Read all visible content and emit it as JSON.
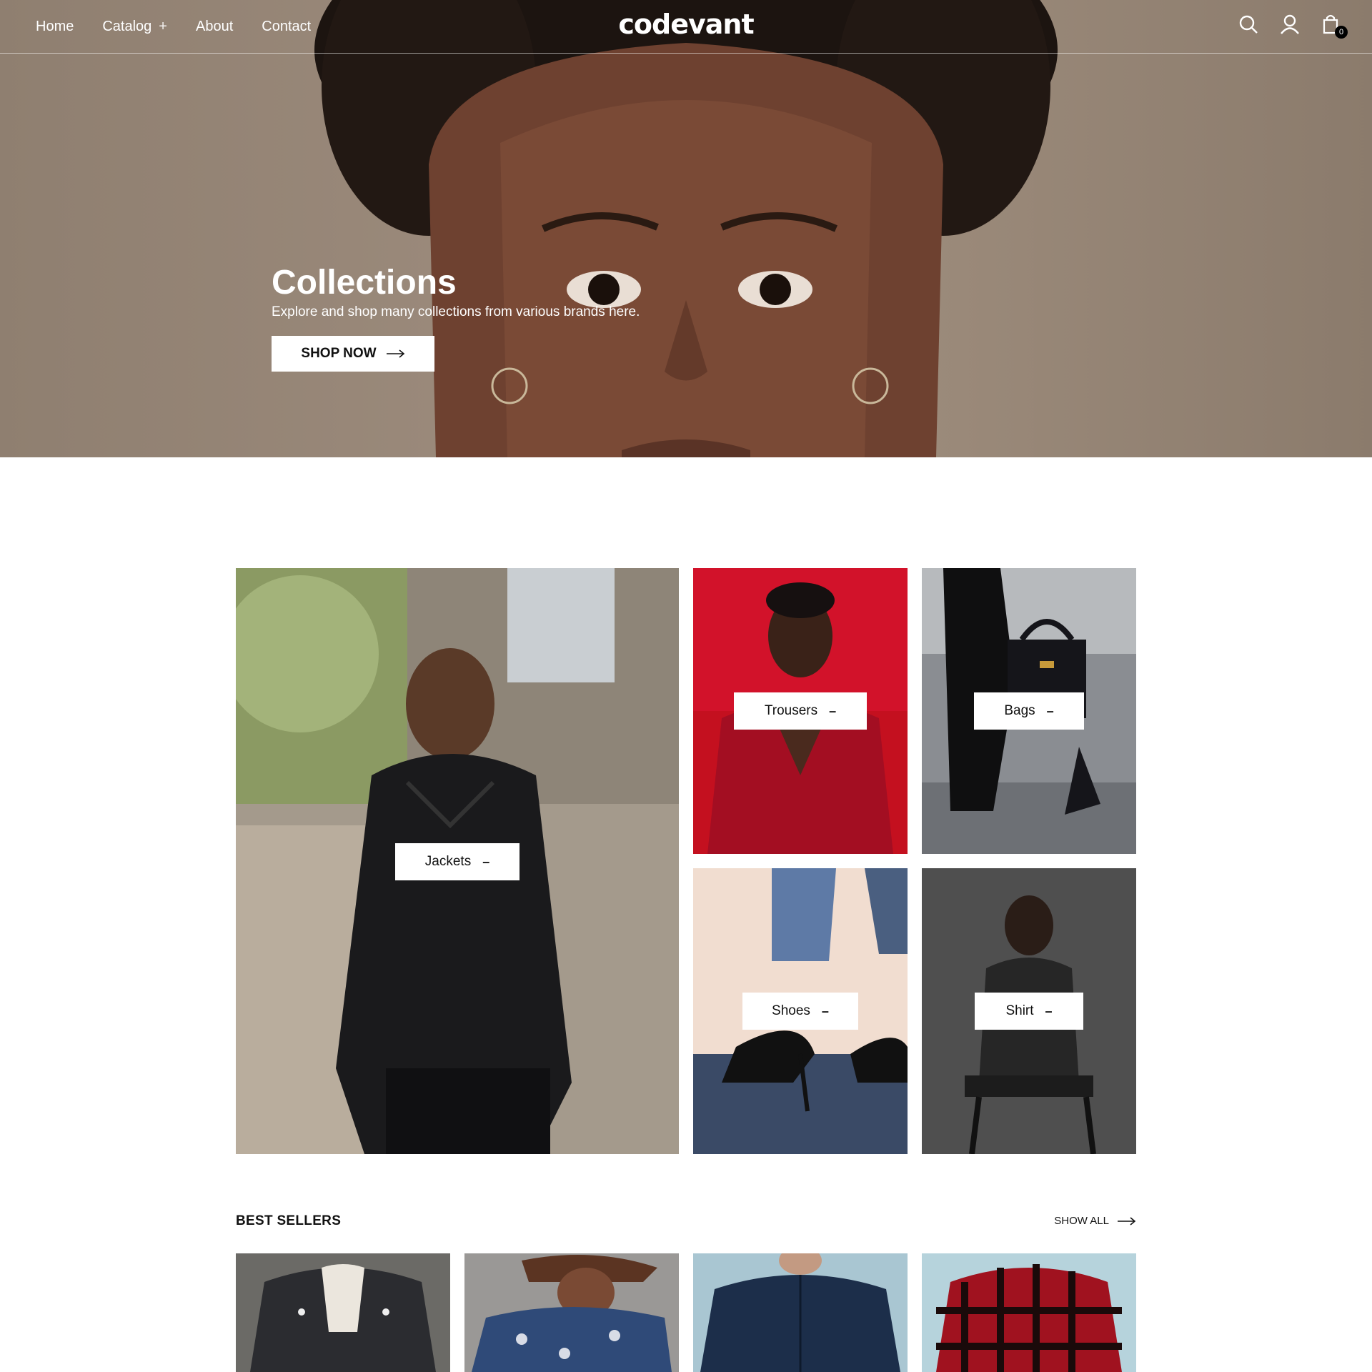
{
  "nav": {
    "links": [
      "Home",
      "Catalog",
      "About",
      "Contact"
    ],
    "catalog_expand_icon": "plus-icon",
    "logo": "codevant",
    "icons": [
      "search-icon",
      "user-icon",
      "cart-icon"
    ],
    "cart_count": "0"
  },
  "hero": {
    "title": "Collections",
    "subtitle": "Explore and shop many collections from various brands here.",
    "button_label": "SHOP NOW"
  },
  "collections": [
    {
      "label": "Jackets"
    },
    {
      "label": "Trousers"
    },
    {
      "label": "Bags"
    },
    {
      "label": "Shoes"
    },
    {
      "label": "Shirt"
    }
  ],
  "best_sellers": {
    "title": "BEST SELLERS",
    "show_all": "SHOW ALL"
  },
  "colors": {
    "hero_bg": "#9b8a7b",
    "text_dark": "#111111",
    "white": "#ffffff"
  }
}
